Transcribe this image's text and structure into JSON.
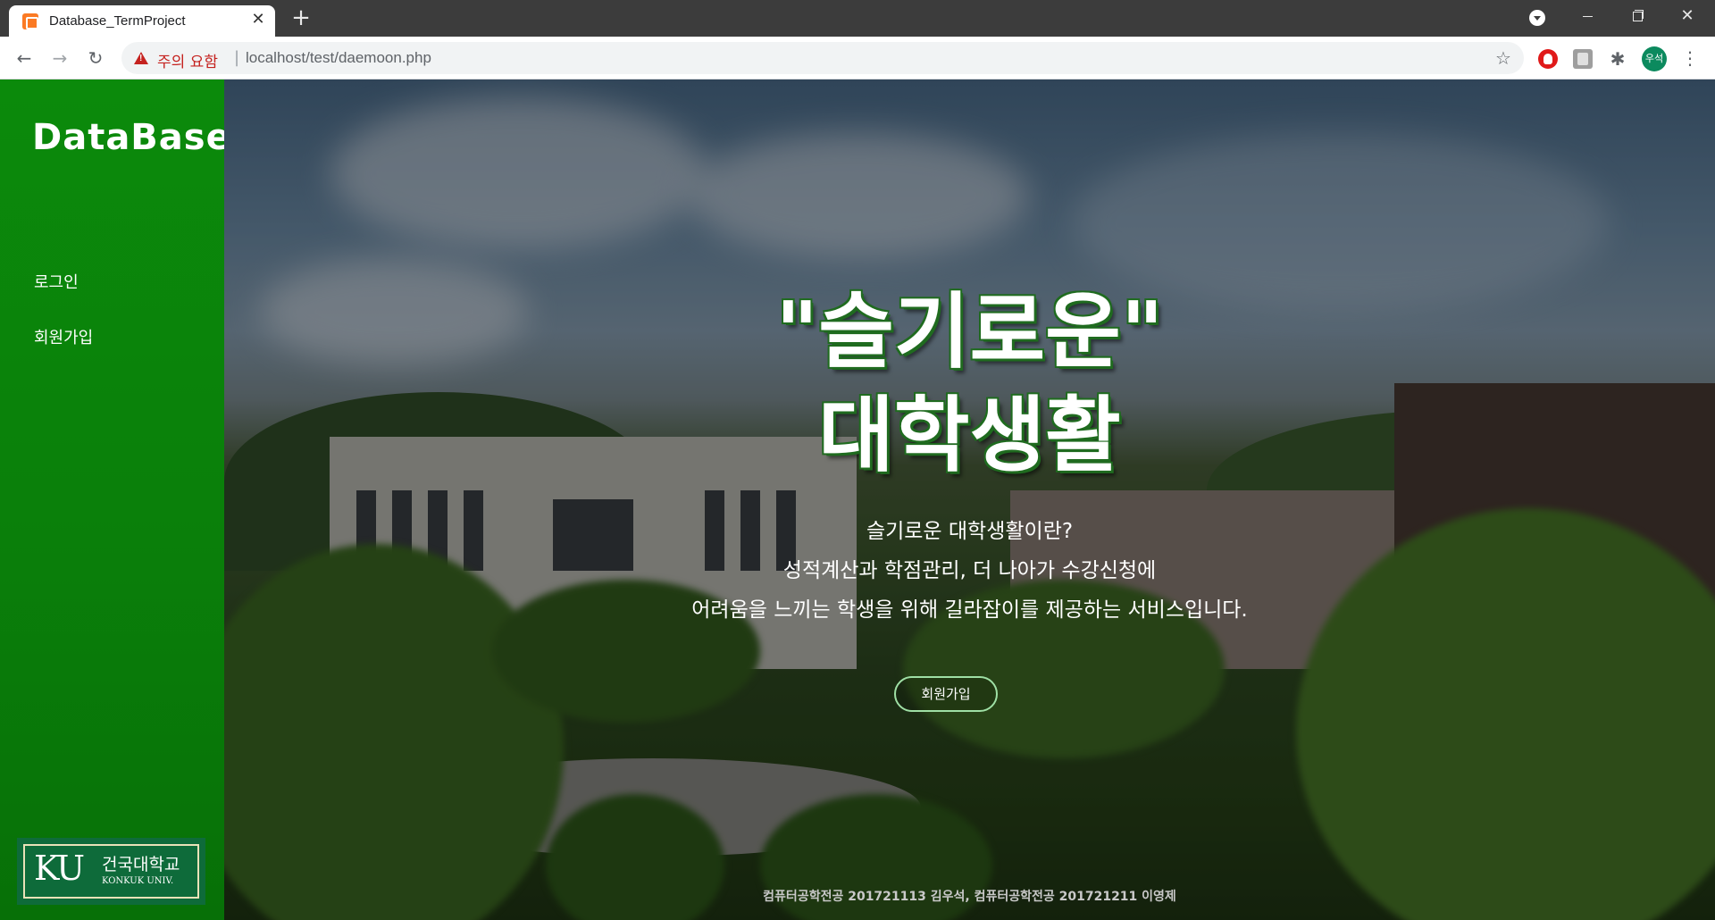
{
  "browser": {
    "tab_title": "Database_TermProject",
    "tab_close": "✕",
    "new_tab": "+",
    "security_warning": "주의 요함",
    "url_separator": "|",
    "url": "localhost/test/daemoon.php",
    "back": "←",
    "forward": "→",
    "reload": "↻",
    "star": "☆",
    "extension_puzzle": "✱",
    "profile_label": "우석",
    "menu": "⋮",
    "win_close": "✕"
  },
  "sidebar": {
    "brand": "DataBase",
    "nav": [
      {
        "label": "로그인"
      },
      {
        "label": "회원가입"
      }
    ],
    "logo": {
      "mark": "KU",
      "korean": "건국대학교",
      "english": "KONKUK UNIV."
    }
  },
  "hero": {
    "headline_line1": "\"슬기로운\"",
    "headline_line2": "대학생활",
    "description": [
      "슬기로운 대학생활이란?",
      "성적계산과 학점관리, 더 나아가 수강신청에",
      "어려움을 느끼는 학생을 위해 길라잡이를 제공하는 서비스입니다."
    ],
    "cta_label": "회원가입",
    "footer": "컴퓨터공학전공 201721113 김우석, 컴퓨터공학전공 201721211 이영제"
  },
  "colors": {
    "sidebar_green": "#0b8a0b",
    "headline_outline": "#1f6b1f",
    "cta_border": "#9fe0a5",
    "warning_red": "#c5221f"
  }
}
